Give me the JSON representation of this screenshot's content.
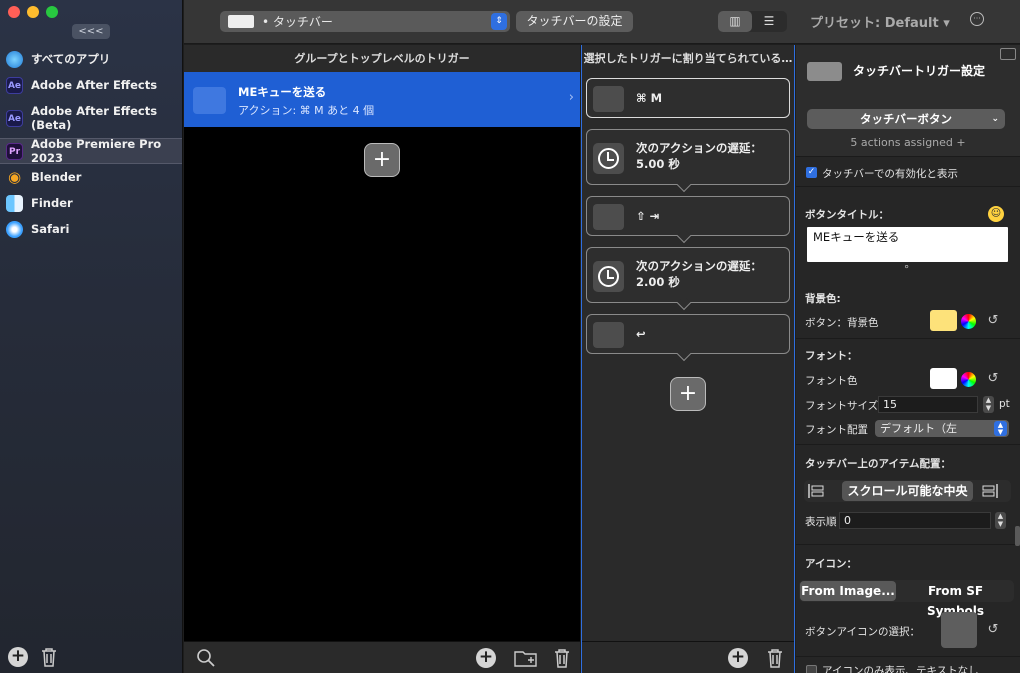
{
  "sidebar": {
    "collapse_label": "<<<",
    "apps": [
      {
        "label": "すべてのアプリ",
        "icon": "globe-icon",
        "abbr": ""
      },
      {
        "label": "Adobe After Effects",
        "icon": "after-effects-icon",
        "abbr": "Ae"
      },
      {
        "label": "Adobe After Effects (Beta)",
        "icon": "after-effects-beta-icon",
        "abbr": "Ae"
      },
      {
        "label": "Adobe Premiere Pro 2023",
        "icon": "premiere-pro-icon",
        "abbr": "Pr"
      },
      {
        "label": "Blender",
        "icon": "blender-icon",
        "abbr": ""
      },
      {
        "label": "Finder",
        "icon": "finder-icon",
        "abbr": ""
      },
      {
        "label": "Safari",
        "icon": "safari-icon",
        "abbr": ""
      }
    ],
    "add_label": "+"
  },
  "toolbar": {
    "type_select": "• タッチバー",
    "settings_button": "タッチバーの設定",
    "preset": "プリセット: Default ▾",
    "view_columns": "▥",
    "view_list": "☰",
    "more": "···"
  },
  "groups": {
    "header": "グループとトップレベルのトリガー",
    "rows": [
      {
        "title": "MEキューを送る",
        "subtitle": "アクション: ⌘ M あと 4 個"
      }
    ],
    "add_label": "+"
  },
  "actions": {
    "header": "選択したトリガーに割り当てられている…",
    "items": [
      {
        "line1": "⌘ M",
        "line2": "",
        "kind": "key"
      },
      {
        "line1": "次のアクションの遅延：",
        "line2": "5.00 秒",
        "kind": "delay"
      },
      {
        "line1": "⇧ ⇥",
        "line2": "",
        "kind": "key"
      },
      {
        "line1": "次のアクションの遅延：",
        "line2": "2.00 秒",
        "kind": "delay"
      },
      {
        "line1": "↩",
        "line2": "",
        "kind": "key"
      }
    ],
    "add_label": "+"
  },
  "inspector": {
    "title": "タッチバートリガー設定",
    "trigger_type": "タッチバーボタン",
    "assigned": "5 actions assigned +",
    "enable_label": "タッチバーでの有効化と表示",
    "button_title_label": "ボタンタイトル：",
    "button_title_value": "MEキューを送る",
    "dot": "°",
    "bg_section": "背景色:",
    "bg_label": "ボタン：背景色",
    "bg_color": "#fde27a",
    "font_section": "フォント：",
    "font_color_label": "フォント色",
    "font_color": "#ffffff",
    "font_size_label": "フォントサイズ",
    "font_size": "15",
    "font_unit": "pt",
    "font_align_label": "フォント配置",
    "font_align": "デフォルト（左",
    "layout_section": "タッチバー上のアイテム配置：",
    "layout_center": "スクロール可能な中央",
    "order_label": "表示順",
    "order_value": "0",
    "icon_section": "アイコン：",
    "from_image": "From Image...",
    "from_sf": "From SF Symbols",
    "choose_icon_label": "ボタンアイコンの選択：",
    "icon_only_label": "アイコンのみ表示、テキストなし"
  },
  "colors": {
    "accent": "#1f5fd4",
    "sidebar_bg": "#262c3a"
  }
}
